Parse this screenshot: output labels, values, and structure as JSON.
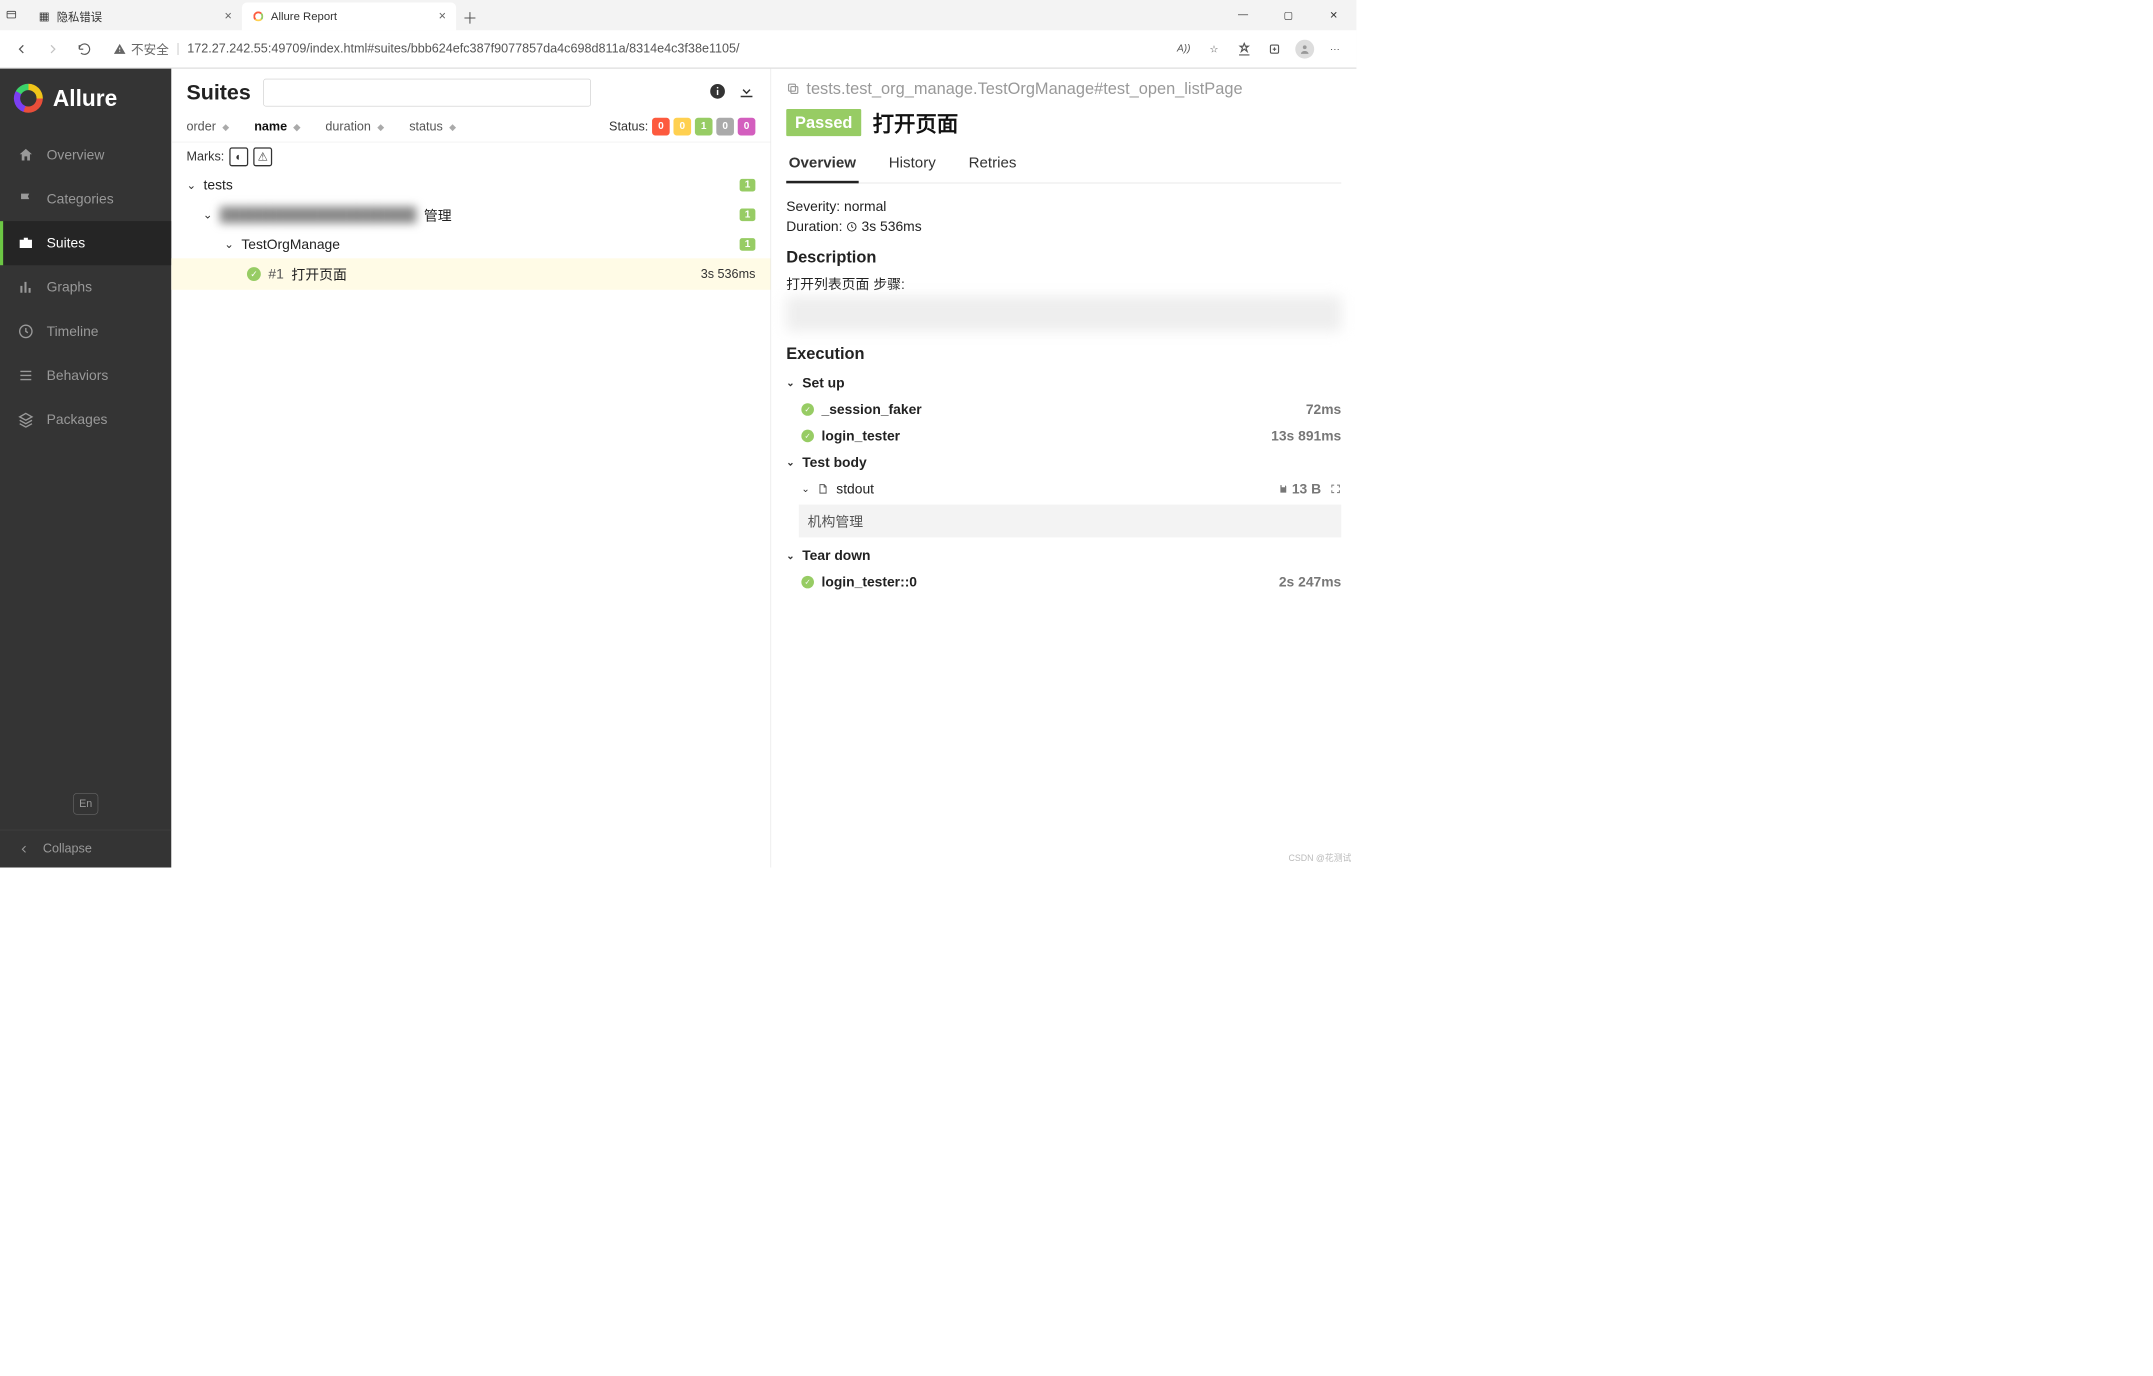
{
  "browser": {
    "tabs": [
      {
        "title": "隐私错误",
        "active": false
      },
      {
        "title": "Allure Report",
        "active": true
      }
    ],
    "address": {
      "insecure_label": "不安全",
      "url": "172.27.242.55:49709/index.html#suites/bbb624efc387f9077857da4c698d811a/8314e4c3f38e1105/"
    },
    "read_aloud_badge": "A))"
  },
  "sidebar": {
    "brand": "Allure",
    "items": [
      {
        "icon": "home-icon",
        "label": "Overview"
      },
      {
        "icon": "flag-icon",
        "label": "Categories"
      },
      {
        "icon": "briefcase-icon",
        "label": "Suites"
      },
      {
        "icon": "barchart-icon",
        "label": "Graphs"
      },
      {
        "icon": "clock-icon",
        "label": "Timeline"
      },
      {
        "icon": "list-icon",
        "label": "Behaviors"
      },
      {
        "icon": "layers-icon",
        "label": "Packages"
      }
    ],
    "lang": "En",
    "collapse": "Collapse"
  },
  "suites": {
    "title": "Suites",
    "sort_cols": [
      "order",
      "name",
      "duration",
      "status"
    ],
    "active_sort": "name",
    "status_label": "Status:",
    "status_counts": [
      "0",
      "0",
      "1",
      "0",
      "0"
    ],
    "marks_label": "Marks:",
    "tree": {
      "root": {
        "label": "tests",
        "count": "1"
      },
      "l1": {
        "label_suffix": "管理",
        "count": "1"
      },
      "l2": {
        "label": "TestOrgManage",
        "count": "1"
      },
      "leaf": {
        "num": "#1",
        "name": "打开页面",
        "duration": "3s 536ms"
      }
    }
  },
  "detail": {
    "crumb": "tests.test_org_manage.TestOrgManage#test_open_listPage",
    "status": "Passed",
    "title": "打开页面",
    "tabs": [
      "Overview",
      "History",
      "Retries"
    ],
    "active_tab": "Overview",
    "severity_label": "Severity: normal",
    "duration_label": "Duration:",
    "duration_value": "3s 536ms",
    "description_h": "Description",
    "description_text": "打开列表页面 步骤:",
    "execution_h": "Execution",
    "setup_h": "Set up",
    "setup_steps": [
      {
        "name": "_session_faker",
        "time": "72ms"
      },
      {
        "name": "login_tester",
        "time": "13s 891ms"
      }
    ],
    "body_h": "Test body",
    "stdout_label": "stdout",
    "stdout_size": "13 B",
    "stdout_content": "机构管理",
    "teardown_h": "Tear down",
    "teardown_steps": [
      {
        "name": "login_tester::0",
        "time": "2s 247ms"
      }
    ]
  },
  "watermark": "CSDN @花测试"
}
